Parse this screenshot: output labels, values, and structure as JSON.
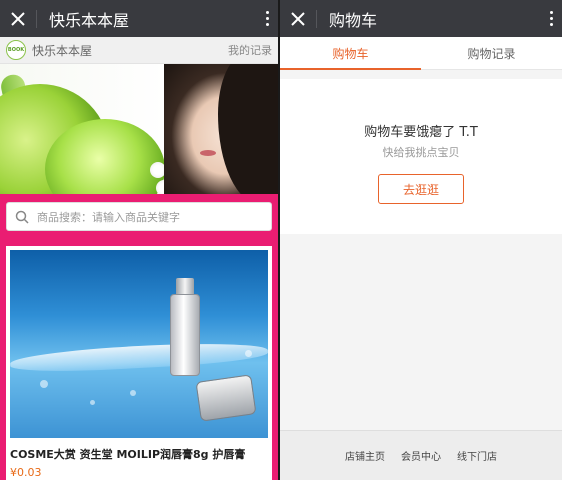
{
  "left": {
    "appbar": {
      "title": "快乐本本屋"
    },
    "shop": {
      "logo_text": "BOOK",
      "name": "快乐本本屋",
      "records_link": "我的记录"
    },
    "search": {
      "placeholder": "商品搜索：请输入商品关键字"
    },
    "product": {
      "title": "COSME大赏 资生堂 MOILIP润唇膏8g 护唇膏",
      "price": "¥0.03"
    },
    "colors": {
      "frame": "#ea1d72",
      "price": "#e86a17"
    }
  },
  "right": {
    "appbar": {
      "title": "购物车"
    },
    "tabs": [
      {
        "label": "购物车",
        "active": true
      },
      {
        "label": "购物记录",
        "active": false
      }
    ],
    "empty": {
      "message": "购物车要饿瘪了 T.T",
      "hint": "快给我挑点宝贝",
      "button": "去逛逛"
    },
    "footer_links": [
      "店铺主页",
      "会员中心",
      "线下门店"
    ],
    "colors": {
      "accent": "#e8632b"
    }
  },
  "icons": {
    "close": "close-icon",
    "more": "more-vertical-icon",
    "search": "search-icon"
  }
}
